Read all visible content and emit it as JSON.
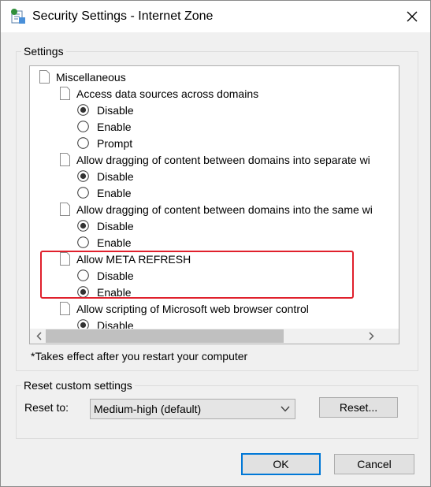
{
  "window": {
    "title": "Security Settings - Internet Zone"
  },
  "settings_group": {
    "label": "Settings"
  },
  "list": {
    "category": "Miscellaneous",
    "items": [
      {
        "label": "Access data sources across domains",
        "options": [
          "Disable",
          "Enable",
          "Prompt"
        ],
        "selected": "Disable"
      },
      {
        "label": "Allow dragging of content between domains into separate wi",
        "options": [
          "Disable",
          "Enable"
        ],
        "selected": "Disable"
      },
      {
        "label": "Allow dragging of content between domains into the same wi",
        "options": [
          "Disable",
          "Enable"
        ],
        "selected": "Disable"
      },
      {
        "label": "Allow META REFRESH",
        "options": [
          "Disable",
          "Enable"
        ],
        "selected": "Enable"
      },
      {
        "label": "Allow scripting of Microsoft web browser control",
        "options": [
          "Disable"
        ],
        "selected": "Disable"
      }
    ]
  },
  "note": "*Takes effect after you restart your computer",
  "reset_group": {
    "label": "Reset custom settings",
    "reset_to_label": "Reset to:",
    "selected_value": "Medium-high (default)",
    "reset_button": "Reset..."
  },
  "buttons": {
    "ok": "OK",
    "cancel": "Cancel"
  },
  "colors": {
    "highlight": "#e0202c",
    "focus": "#0078d7"
  }
}
